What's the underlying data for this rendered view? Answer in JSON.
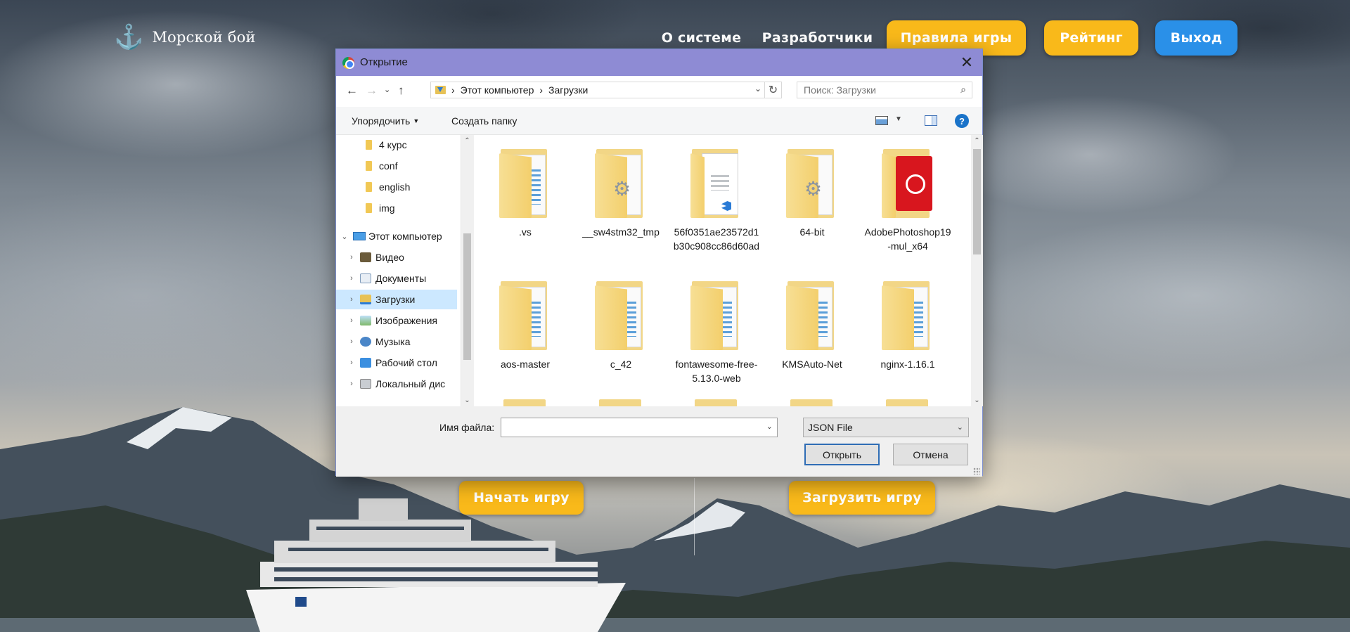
{
  "site": {
    "logo_text": "Морской бой",
    "nav": {
      "about": "О системе",
      "developers": "Разработчики",
      "rules": "Правила игры",
      "rating": "Рейтинг",
      "exit": "Выход"
    },
    "start_game": "Начать игру",
    "load_game": "Загрузить игру",
    "colors": {
      "accent_yellow": "#f9b91a",
      "accent_blue": "#2a90e8"
    }
  },
  "dialog": {
    "title": "Открытие",
    "breadcrumb": [
      "Этот компьютер",
      "Загрузки"
    ],
    "search_placeholder": "Поиск: Загрузки",
    "toolbar": {
      "organize": "Упорядочить",
      "new_folder": "Создать папку"
    },
    "tree": [
      {
        "label": "4 курс",
        "icon": "folder-icon"
      },
      {
        "label": "conf",
        "icon": "folder-icon"
      },
      {
        "label": "english",
        "icon": "folder-icon"
      },
      {
        "label": "img",
        "icon": "folder-icon"
      },
      {
        "label": "Этот компьютер",
        "icon": "computer-icon"
      },
      {
        "label": "Видео",
        "icon": "video-library-icon"
      },
      {
        "label": "Документы",
        "icon": "documents-library-icon"
      },
      {
        "label": "Загрузки",
        "icon": "downloads-icon",
        "selected": true
      },
      {
        "label": "Изображения",
        "icon": "pictures-library-icon"
      },
      {
        "label": "Музыка",
        "icon": "music-library-icon"
      },
      {
        "label": "Рабочий стол",
        "icon": "desktop-icon"
      },
      {
        "label": "Локальный дис",
        "icon": "local-disk-icon"
      }
    ],
    "files": [
      {
        "name": ".vs",
        "icon": "folder-icon"
      },
      {
        "name": "__sw4stm32_tmp",
        "icon": "settings-folder-icon"
      },
      {
        "name": "56f0351ae23572d1b30c908cc86d60ad",
        "icon": "vscode-file-icon"
      },
      {
        "name": "64-bit",
        "icon": "settings-folder-icon"
      },
      {
        "name": "AdobePhotoshop19-mul_x64",
        "icon": "adobe-folder-icon"
      },
      {
        "name": "aos-master",
        "icon": "folder-icon"
      },
      {
        "name": "c_42",
        "icon": "folder-icon"
      },
      {
        "name": "fontawesome-free-5.13.0-web",
        "icon": "folder-icon"
      },
      {
        "name": "KMSAuto-Net",
        "icon": "folder-icon"
      },
      {
        "name": "nginx-1.16.1",
        "icon": "folder-icon"
      }
    ],
    "filename_label": "Имя файла:",
    "filename_value": "",
    "filetype": "JSON File",
    "open_button": "Открыть",
    "cancel_button": "Отмена"
  }
}
